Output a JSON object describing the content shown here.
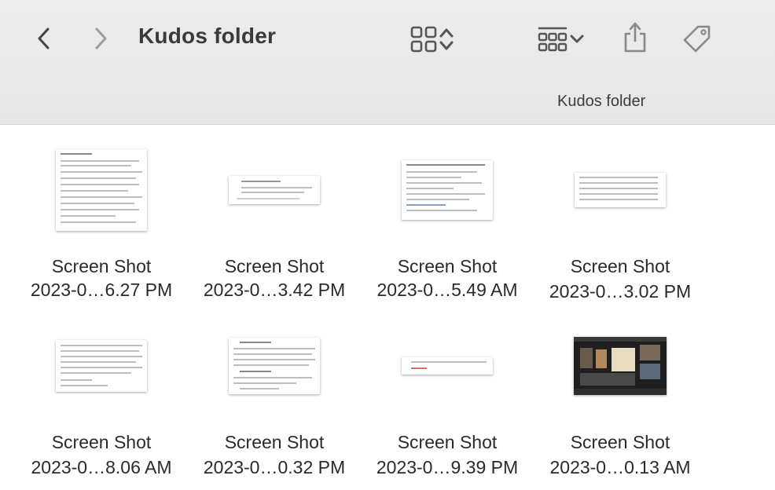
{
  "window": {
    "title": "Kudos folder",
    "path_label": "Kudos folder"
  },
  "toolbar": {
    "back_icon": "chevron-left-icon",
    "forward_icon": "chevron-right-icon",
    "view_icon": "grid-view-icon",
    "group_icon": "group-by-icon",
    "share_icon": "share-icon",
    "tag_icon": "tag-icon"
  },
  "files": [
    {
      "name_line1": "Screen Shot",
      "name_line2": "2023-0…6.27 PM"
    },
    {
      "name_line1": "Screen Shot",
      "name_line2": "2023-0…3.42 PM"
    },
    {
      "name_line1": "Screen Shot",
      "name_line2": "2023-0…5.49 AM"
    },
    {
      "name_line1": "Screen Shot",
      "name_line2": "2023-0…3.02 PM"
    },
    {
      "name_line1": "Screen Shot",
      "name_line2": "2023-0…8.06 AM"
    },
    {
      "name_line1": "Screen Shot",
      "name_line2": "2023-0…0.32 PM"
    },
    {
      "name_line1": "Screen Shot",
      "name_line2": "2023-0…9.39 PM"
    },
    {
      "name_line1": "Screen Shot",
      "name_line2": "2023-0…0.13 AM"
    }
  ]
}
